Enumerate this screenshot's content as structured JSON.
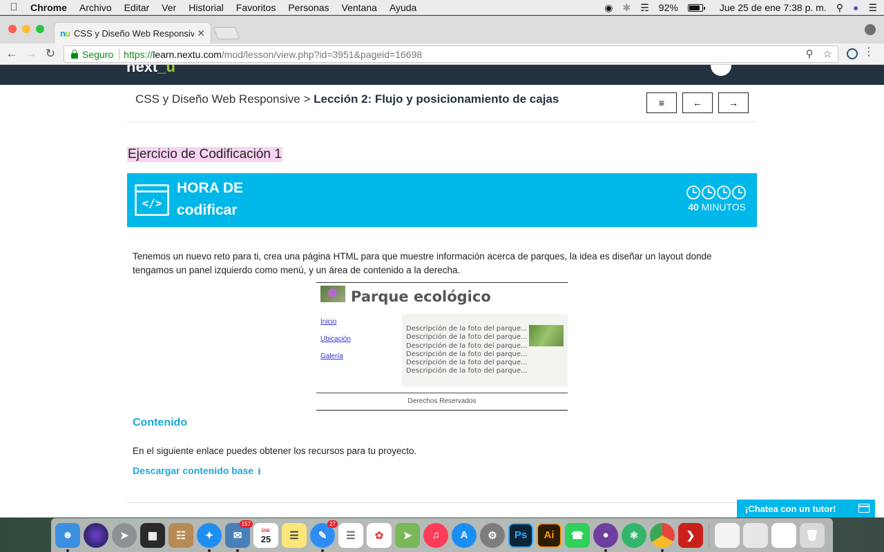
{
  "menubar": {
    "apple": "",
    "app": "Chrome",
    "items": [
      "Archivo",
      "Editar",
      "Ver",
      "Historial",
      "Favoritos",
      "Personas",
      "Ventana",
      "Ayuda"
    ],
    "battery": "92%",
    "battery_level": 0.92,
    "datetime": "Jue 25 de ene  7:38 p. m."
  },
  "browser": {
    "tab_title": "CSS y Diseño Web Responsive",
    "tab_favicon": "nu",
    "secure_label": "Seguro",
    "url_scheme": "https://",
    "url_host": "learn.nextu.com",
    "url_path": "/mod/lesson/view.php?id=3951&pageid=16698"
  },
  "page": {
    "breadcrumb_course": "CSS y Diseño Web Responsive",
    "breadcrumb_sep": " > ",
    "breadcrumb_current": "Lección 2: Flujo y posicionamiento de cajas",
    "nav_menu": "≡",
    "nav_prev": "←",
    "nav_next": "→",
    "exercise_title": "Ejercicio de Codificación 1",
    "banner": {
      "line1": "HORA DE",
      "line2": "codificar",
      "minutes_number": "40",
      "minutes_label": " MINUTOS",
      "icon_text": "</>"
    },
    "intro": "Tenemos un nuevo reto para ti, crea una página HTML para que muestre información acerca de parques, la idea es diseñar un layout donde tengamos un panel izquierdo como menú, y un área de contenido a la derecha.",
    "preview": {
      "title": "Parque ecológico",
      "links": [
        "Inicio",
        "Ubicación",
        "Galería"
      ],
      "descriptions": [
        "Descripción de la foto del parque...",
        "Descripción de la foto del parque...",
        "Descripción de la foto del parque...",
        "Descripción de la foto del parque...",
        "Descripción de la foto del parque...",
        "Descripción de la foto del parque..."
      ],
      "footer": "Derechos Reservados"
    },
    "content_heading": "Contenido",
    "content_text": "En el siguiente enlace puedes obtener los recursos para tu proyecto.",
    "download_link": "Descargar contenido base",
    "chat_label": "¡Chatea con un tutor!"
  },
  "dock": {
    "calendar_month": "ENE",
    "calendar_day": "25",
    "badges": {
      "mail": "157",
      "messages": "27"
    }
  },
  "colors": {
    "accent": "#00b7e9",
    "header_dark": "#233241",
    "highlight": "#f8d4f3",
    "link": "#1aa9d9"
  }
}
